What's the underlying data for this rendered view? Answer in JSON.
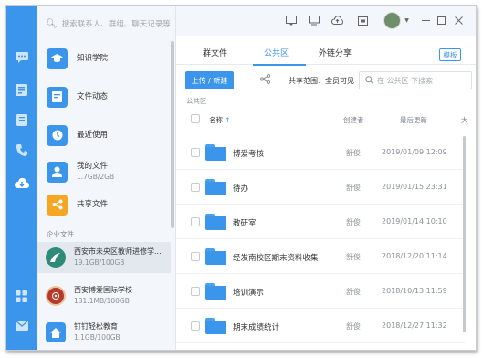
{
  "search": {
    "placeholder": "搜索联系人、群组、聊天记录等"
  },
  "nav": [
    {
      "label": "知识学院",
      "sub": "",
      "icon": "graduation-cap-icon",
      "color": "#3b95ea"
    },
    {
      "label": "文件动态",
      "sub": "",
      "icon": "file-activity-icon",
      "color": "#3b95ea"
    },
    {
      "label": "最近使用",
      "sub": "",
      "icon": "clock-icon",
      "color": "#3b95ea"
    },
    {
      "label": "我的文件",
      "sub": "1.7GB/2GB",
      "icon": "user-icon",
      "color": "#3b95ea"
    },
    {
      "label": "共享文件",
      "sub": "",
      "icon": "share-icon",
      "color": "#f5a623"
    }
  ],
  "enterprise_section": "企业文件",
  "enterprises": [
    {
      "label": "西安市未央区教师进修学...",
      "sub": "19.1GB/100GB",
      "color": "#2e8b7a"
    },
    {
      "label": "西安博爱国际学校",
      "sub": "131.1MB/100GB",
      "color": "#b53a2a"
    },
    {
      "label": "钉钉轻松教育",
      "sub": "1.1GB/100GB",
      "color": "#3b95ea"
    }
  ],
  "tabs": [
    "群文件",
    "公共区",
    "外链分享"
  ],
  "template_label": "模板",
  "upload_label": "上传 / 新建",
  "scope_text": "共享范围：全员可见",
  "file_search_placeholder": "在 公共区 下搜索",
  "breadcrumb": "公共区",
  "columns": {
    "name": "名称",
    "sort_arrow": "↑",
    "creator": "创建者",
    "updated": "最后更新",
    "size": "大"
  },
  "files": [
    {
      "name": "博爱考核",
      "owner": "舒俊",
      "time": "2019/01/09 12:09"
    },
    {
      "name": "待办",
      "owner": "舒俊",
      "time": "2019/01/15 23:31"
    },
    {
      "name": "教研室",
      "owner": "舒俊",
      "time": "2019/01/14 10:10"
    },
    {
      "name": "经发南校区期末资料收集",
      "owner": "舒俊",
      "time": "2018/12/20 11:14"
    },
    {
      "name": "培训演示",
      "owner": "舒俊",
      "time": "2018/10/13 11:59"
    },
    {
      "name": "期末成绩统计",
      "owner": "舒俊",
      "time": "2018/12/27 11:32"
    }
  ],
  "colors": {
    "accent": "#3b95ea",
    "rail": "#3b95ea",
    "sidebar_bg": "#f3f6fa"
  }
}
